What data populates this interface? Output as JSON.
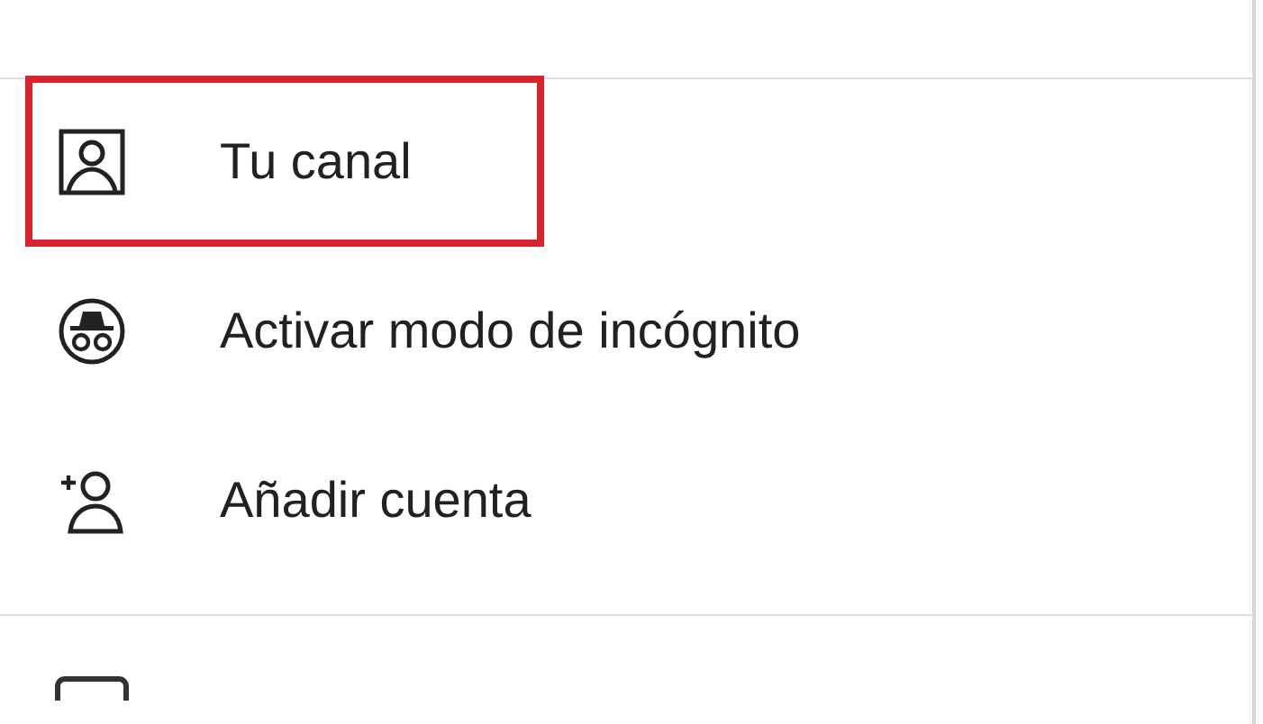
{
  "menu_items": [
    {
      "kind": "channel",
      "label": "Tu canal",
      "highlighted": true
    },
    {
      "kind": "incognito",
      "label": "Activar modo de incógnito",
      "highlighted": false
    },
    {
      "kind": "add-account",
      "label": "Añadir cuenta",
      "highlighted": false
    }
  ]
}
